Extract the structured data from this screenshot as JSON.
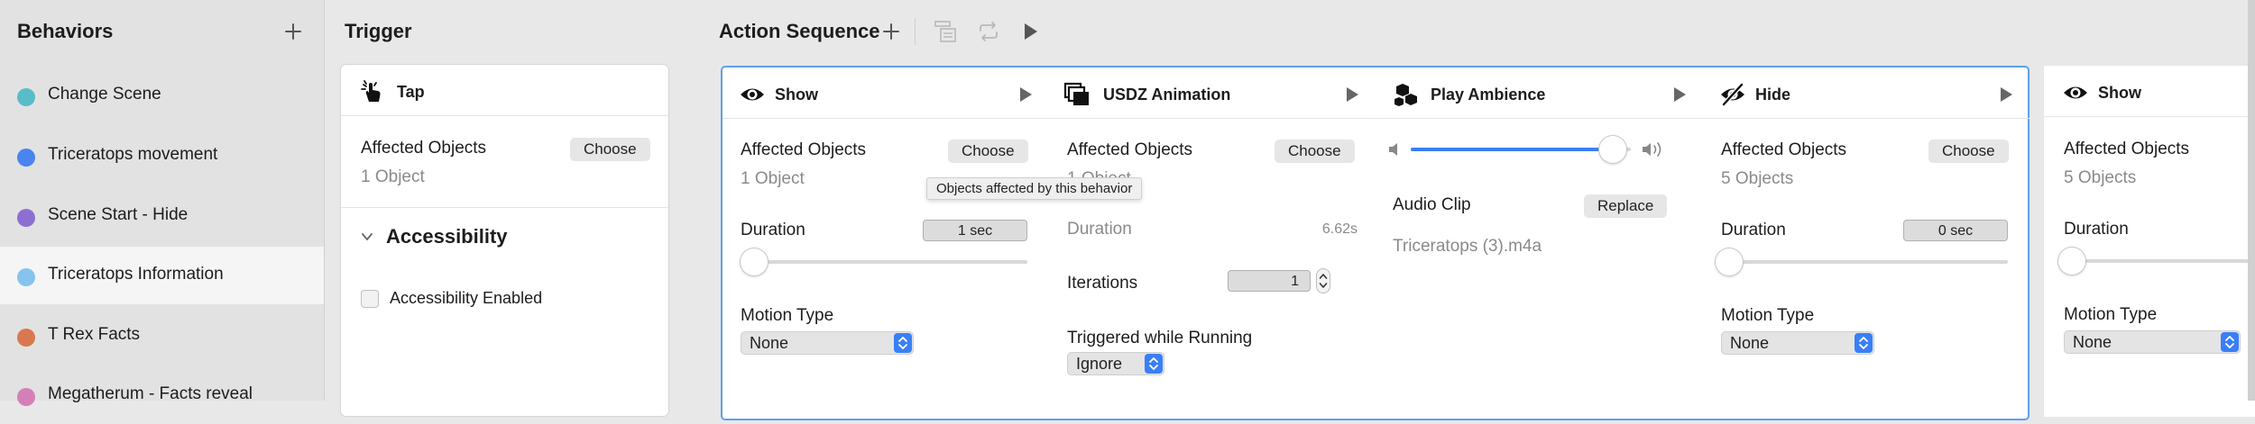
{
  "sidebar": {
    "title": "Behaviors",
    "items": [
      {
        "label": "Change Scene",
        "color": "#59bcc9"
      },
      {
        "label": "Triceratops movement",
        "color": "#4b83f0"
      },
      {
        "label": "Scene Start - Hide",
        "color": "#8d6fd1"
      },
      {
        "label": "Triceratops Information",
        "color": "#86c3ef",
        "selected": true
      },
      {
        "label": "T Rex Facts",
        "color": "#d9784f"
      },
      {
        "label": "Megatherum - Facts reveal",
        "color": "#d57fb8"
      }
    ]
  },
  "trigger": {
    "title": "Trigger",
    "card": {
      "name": "Tap",
      "affected_label": "Affected Objects",
      "affected_value": "1 Object",
      "choose_label": "Choose",
      "accessibility_title": "Accessibility",
      "accessibility_checkbox_label": "Accessibility Enabled"
    }
  },
  "sequence": {
    "title": "Action Sequence",
    "tooltip": "Objects affected by this behavior",
    "show1": {
      "name": "Show",
      "affected_label": "Affected Objects",
      "affected_value": "1 Object",
      "choose_label": "Choose",
      "duration_label": "Duration",
      "duration_value": "1 sec",
      "motion_label": "Motion Type",
      "motion_value": "None"
    },
    "usdz": {
      "name": "USDZ Animation",
      "affected_label": "Affected Objects",
      "affected_value": "1 Object",
      "choose_label": "Choose",
      "duration_label": "Duration",
      "duration_value": "6.62s",
      "iterations_label": "Iterations",
      "iterations_value": "1",
      "triggered_label": "Triggered while Running",
      "triggered_value": "Ignore"
    },
    "ambience": {
      "name": "Play Ambience",
      "volume": 0.92,
      "audio_label": "Audio Clip",
      "replace_label": "Replace",
      "audio_file": "Triceratops (3).m4a"
    },
    "hide": {
      "name": "Hide",
      "affected_label": "Affected Objects",
      "affected_value": "5 Objects",
      "choose_label": "Choose",
      "duration_label": "Duration",
      "duration_value": "0 sec",
      "motion_label": "Motion Type",
      "motion_value": "None"
    },
    "show2": {
      "name": "Show",
      "affected_label": "Affected Objects",
      "affected_value": "5 Objects",
      "duration_label": "Duration",
      "motion_label": "Motion Type",
      "motion_value": "None"
    }
  }
}
